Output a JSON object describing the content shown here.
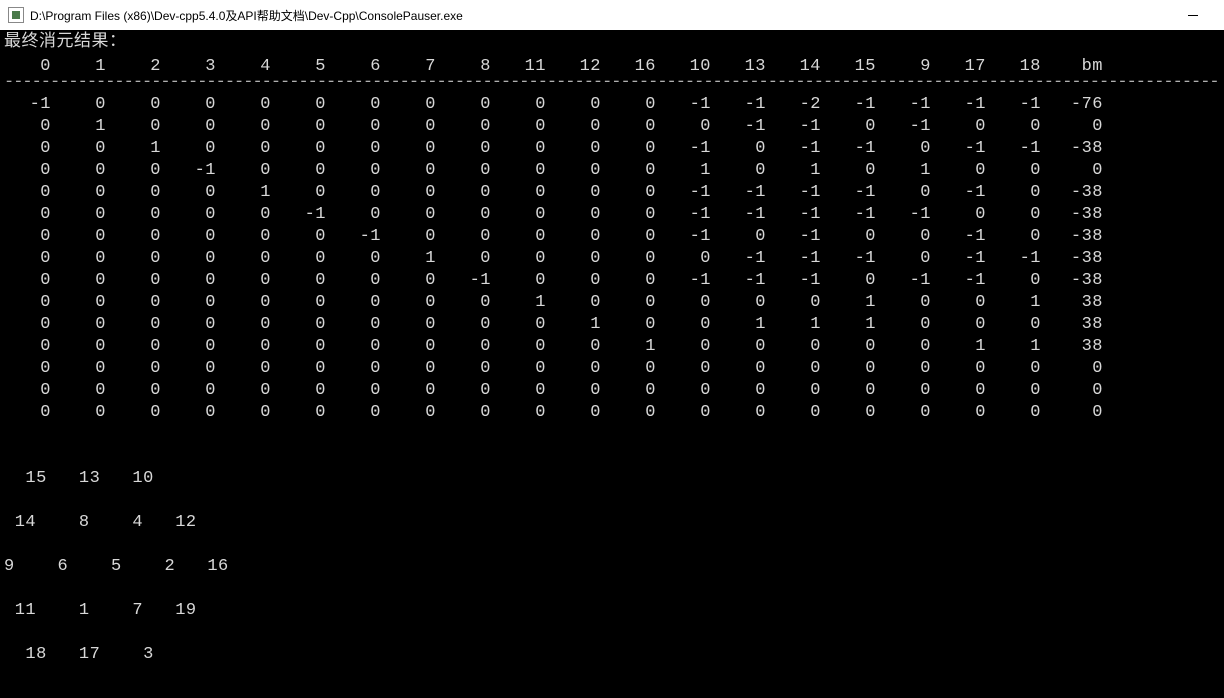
{
  "window": {
    "title": "D:\\Program Files (x86)\\Dev-cpp5.4.0及API帮助文档\\Dev-Cpp\\ConsolePauser.exe"
  },
  "console": {
    "header_text": "最终消元结果：",
    "columns": [
      "0",
      "1",
      "2",
      "3",
      "4",
      "5",
      "6",
      "7",
      "8",
      "11",
      "12",
      "16",
      "10",
      "13",
      "14",
      "15",
      "9",
      "17",
      "18",
      "bm"
    ],
    "rows": [
      [
        "-1",
        "0",
        "0",
        "0",
        "0",
        "0",
        "0",
        "0",
        "0",
        "0",
        "0",
        "0",
        "-1",
        "-1",
        "-2",
        "-1",
        "-1",
        "-1",
        "-1",
        "-76"
      ],
      [
        "0",
        "1",
        "0",
        "0",
        "0",
        "0",
        "0",
        "0",
        "0",
        "0",
        "0",
        "0",
        "0",
        "-1",
        "-1",
        "0",
        "-1",
        "0",
        "0",
        "0"
      ],
      [
        "0",
        "0",
        "1",
        "0",
        "0",
        "0",
        "0",
        "0",
        "0",
        "0",
        "0",
        "0",
        "-1",
        "0",
        "-1",
        "-1",
        "0",
        "-1",
        "-1",
        "-38"
      ],
      [
        "0",
        "0",
        "0",
        "-1",
        "0",
        "0",
        "0",
        "0",
        "0",
        "0",
        "0",
        "0",
        "1",
        "0",
        "1",
        "0",
        "1",
        "0",
        "0",
        "0"
      ],
      [
        "0",
        "0",
        "0",
        "0",
        "1",
        "0",
        "0",
        "0",
        "0",
        "0",
        "0",
        "0",
        "-1",
        "-1",
        "-1",
        "-1",
        "0",
        "-1",
        "0",
        "-38"
      ],
      [
        "0",
        "0",
        "0",
        "0",
        "0",
        "-1",
        "0",
        "0",
        "0",
        "0",
        "0",
        "0",
        "-1",
        "-1",
        "-1",
        "-1",
        "-1",
        "0",
        "0",
        "-38"
      ],
      [
        "0",
        "0",
        "0",
        "0",
        "0",
        "0",
        "-1",
        "0",
        "0",
        "0",
        "0",
        "0",
        "-1",
        "0",
        "-1",
        "0",
        "0",
        "-1",
        "0",
        "-38"
      ],
      [
        "0",
        "0",
        "0",
        "0",
        "0",
        "0",
        "0",
        "1",
        "0",
        "0",
        "0",
        "0",
        "0",
        "-1",
        "-1",
        "-1",
        "0",
        "-1",
        "-1",
        "-38"
      ],
      [
        "0",
        "0",
        "0",
        "0",
        "0",
        "0",
        "0",
        "0",
        "-1",
        "0",
        "0",
        "0",
        "-1",
        "-1",
        "-1",
        "0",
        "-1",
        "-1",
        "0",
        "-38"
      ],
      [
        "0",
        "0",
        "0",
        "0",
        "0",
        "0",
        "0",
        "0",
        "0",
        "1",
        "0",
        "0",
        "0",
        "0",
        "0",
        "1",
        "0",
        "0",
        "1",
        "38"
      ],
      [
        "0",
        "0",
        "0",
        "0",
        "0",
        "0",
        "0",
        "0",
        "0",
        "0",
        "1",
        "0",
        "0",
        "1",
        "1",
        "1",
        "0",
        "0",
        "0",
        "38"
      ],
      [
        "0",
        "0",
        "0",
        "0",
        "0",
        "0",
        "0",
        "0",
        "0",
        "0",
        "0",
        "1",
        "0",
        "0",
        "0",
        "0",
        "0",
        "1",
        "1",
        "38"
      ],
      [
        "0",
        "0",
        "0",
        "0",
        "0",
        "0",
        "0",
        "0",
        "0",
        "0",
        "0",
        "0",
        "0",
        "0",
        "0",
        "0",
        "0",
        "0",
        "0",
        "0"
      ],
      [
        "0",
        "0",
        "0",
        "0",
        "0",
        "0",
        "0",
        "0",
        "0",
        "0",
        "0",
        "0",
        "0",
        "0",
        "0",
        "0",
        "0",
        "0",
        "0",
        "0"
      ],
      [
        "0",
        "0",
        "0",
        "0",
        "0",
        "0",
        "0",
        "0",
        "0",
        "0",
        "0",
        "0",
        "0",
        "0",
        "0",
        "0",
        "0",
        "0",
        "0",
        "0"
      ]
    ],
    "bottom_lines": [
      "  15   13   10",
      " 14    8    4   12",
      "9    6    5    2   16",
      " 11    1    7   19",
      "  18   17    3"
    ]
  }
}
